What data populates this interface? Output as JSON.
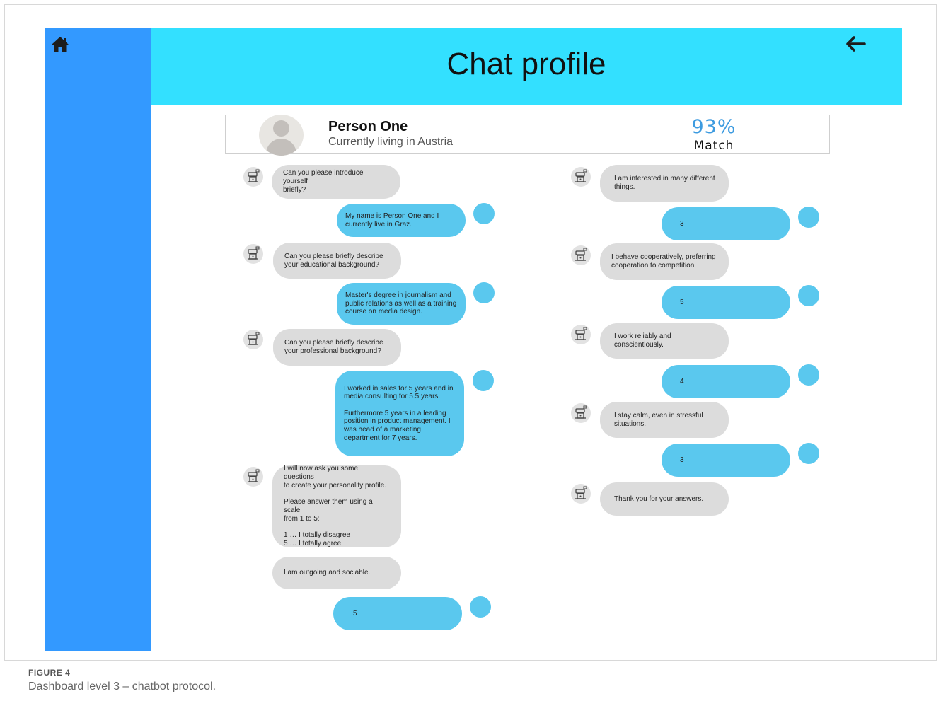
{
  "header": {
    "title": "Chat profile"
  },
  "nav": {
    "home_icon": "home-icon",
    "back_icon": "arrow-left-icon"
  },
  "profile": {
    "name": "Person One",
    "location": "Currently living in Austria",
    "match_percent": "93%",
    "match_label": "Match"
  },
  "chat_left": {
    "m1": "Can you please introduce yourself\nbriefly?",
    "m2": "My name is Person One and I\ncurrently live in Graz.",
    "m3": "Can you please briefly describe\nyour educational background?",
    "m4": "Master's degree in journalism and\npublic relations as well as a training\ncourse on media design.",
    "m5": "Can you please briefly describe\nyour professional background?",
    "m6": "I worked in sales for 5 years and in\nmedia consulting for 5.5 years.\n\nFurthermore 5 years in a leading\nposition in product management. I\nwas head of a marketing\ndepartment for 7 years.",
    "m7": "I will now ask you some questions\nto create your personality profile.\n\nPlease answer them using a scale\nfrom 1 to 5:\n\n1 … I totally disagree\n5 … I totally agree",
    "m8": "I am outgoing and sociable.",
    "m9": "5"
  },
  "chat_right": {
    "m1": "I am interested in many different\nthings.",
    "m2": "3",
    "m3": "I behave cooperatively, preferring\ncooperation to competition.",
    "m4": "5",
    "m5": "I work reliably and conscientiously.",
    "m6": "4",
    "m7": "I stay calm, even in stressful\nsituations.",
    "m8": "3",
    "m9": "Thank you for your answers."
  },
  "caption": {
    "label": "FIGURE 4",
    "text": "Dashboard level 3 – chatbot protocol."
  },
  "colors": {
    "sidebar": "#3399ff",
    "header": "#33e0ff",
    "user_bubble": "#5ac8ee",
    "bot_bubble": "#dcdcdc",
    "match_accent": "#3d9be0"
  }
}
